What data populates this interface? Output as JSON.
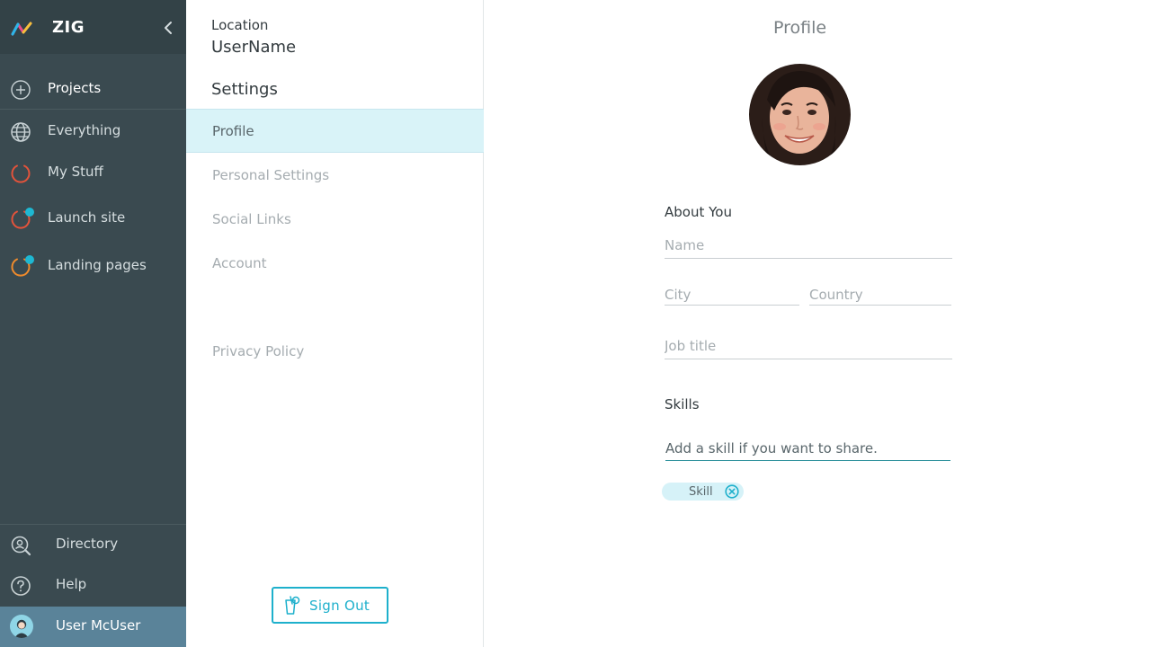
{
  "app": {
    "name": "ZIG"
  },
  "sidebar": {
    "items": [
      {
        "label": "Projects",
        "icon": "plus-circle-icon"
      },
      {
        "label": "Everything",
        "icon": "globe-icon"
      },
      {
        "label": "My Stuff",
        "icon": "ring-red-icon"
      },
      {
        "label": "Launch site",
        "icon": "ring-red-icon"
      },
      {
        "label": "Landing pages",
        "icon": "ring-orange-icon"
      }
    ],
    "footer": [
      {
        "label": "Directory",
        "icon": "search-person-icon"
      },
      {
        "label": "Help",
        "icon": "question-icon"
      }
    ],
    "user": {
      "label": "User McUser",
      "icon": "user-avatar-icon"
    }
  },
  "settings": {
    "location_label": "Location",
    "user_name": "UserName",
    "title": "Settings",
    "items": [
      "Profile",
      "Personal Settings",
      "Social Links",
      "Account"
    ],
    "privacy": "Privacy Policy",
    "sign_out": "Sign Out"
  },
  "profile": {
    "heading": "Profile",
    "about_label": "About You",
    "name_placeholder": "Name",
    "city_placeholder": "City",
    "country_placeholder": "Country",
    "job_placeholder": "Job title",
    "skills_label": "Skills",
    "skill_placeholder": "Add a skill if you want to share.",
    "skills": [
      "Skill"
    ]
  },
  "colors": {
    "sidebar_bg": "#3a4a50",
    "accent": "#1eb0cc",
    "active_bg": "#d9f3f8",
    "badge": "#1eb8d2",
    "ring_red": "#e2533b",
    "ring_orange": "#ef8b2c"
  }
}
